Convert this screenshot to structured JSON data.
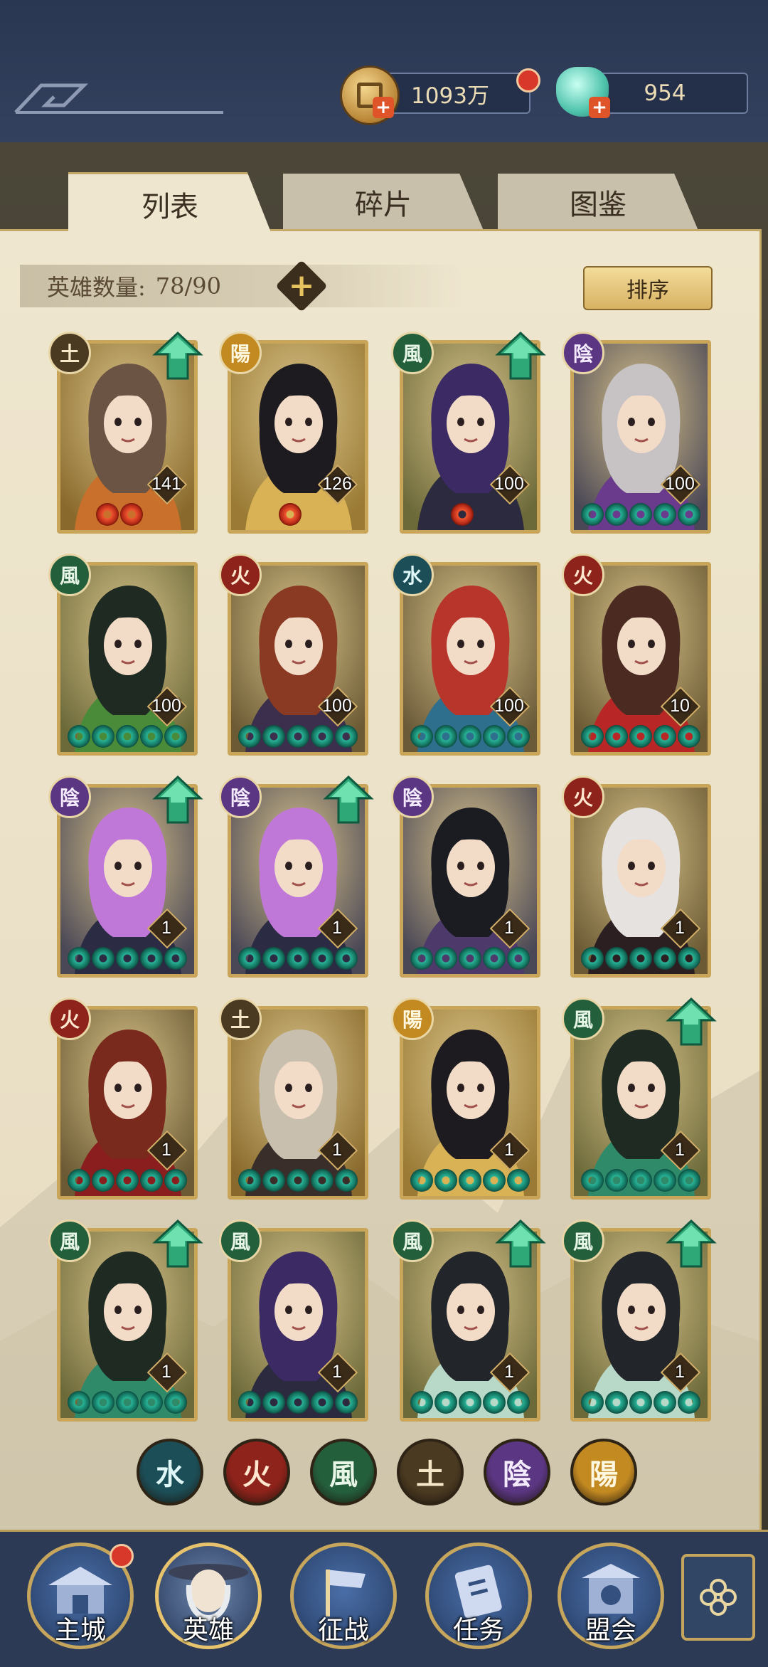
{
  "resources": {
    "gold_value": "1093万",
    "gem_value": "954",
    "gold_icon": "coin-icon",
    "gem_icon": "shell-gem-icon"
  },
  "tabs": [
    {
      "label": "列表",
      "active": true
    },
    {
      "label": "碎片",
      "active": false
    },
    {
      "label": "图鉴",
      "active": false
    }
  ],
  "hero_count": {
    "label": "英雄数量:",
    "value": "78/90"
  },
  "sort_button": {
    "label": "排序"
  },
  "element_glyphs": {
    "earth": "土",
    "yang": "陽",
    "wind": "風",
    "yin": "陰",
    "fire": "火",
    "water": "水"
  },
  "heroes": [
    {
      "element": "earth",
      "level": "141",
      "star_type": "red",
      "stars": 2,
      "upgrade": true,
      "hair": "#6b5444",
      "outfit": "#c9712c"
    },
    {
      "element": "yang",
      "level": "126",
      "star_type": "red",
      "stars": 1,
      "upgrade": false,
      "hair": "#1d1b1f",
      "outfit": "#d8b254"
    },
    {
      "element": "wind",
      "level": "100",
      "star_type": "red",
      "stars": 1,
      "upgrade": true,
      "hair": "#3b2a63",
      "outfit": "#2b2a3e"
    },
    {
      "element": "yin",
      "level": "100",
      "star_type": "jade",
      "stars": 5,
      "upgrade": false,
      "hair": "#c7c2c4",
      "outfit": "#6a3b8c"
    },
    {
      "element": "wind",
      "level": "100",
      "star_type": "jade",
      "stars": 5,
      "upgrade": false,
      "hair": "#1f2a22",
      "outfit": "#4a8b3a"
    },
    {
      "element": "fire",
      "level": "100",
      "star_type": "jade",
      "stars": 5,
      "upgrade": false,
      "hair": "#8a3a22",
      "outfit": "#3b2f4d"
    },
    {
      "element": "water",
      "level": "100",
      "star_type": "jade",
      "stars": 5,
      "upgrade": false,
      "hair": "#b8352b",
      "outfit": "#2f6f8e"
    },
    {
      "element": "fire",
      "level": "10",
      "star_type": "jade",
      "stars": 5,
      "upgrade": false,
      "hair": "#4b2a22",
      "outfit": "#b82626"
    },
    {
      "element": "yin",
      "level": "1",
      "star_type": "jade",
      "stars": 5,
      "upgrade": true,
      "hair": "#c078d8",
      "outfit": "#2b2b44"
    },
    {
      "element": "yin",
      "level": "1",
      "star_type": "jade",
      "stars": 5,
      "upgrade": true,
      "hair": "#c078d8",
      "outfit": "#2b2b44"
    },
    {
      "element": "yin",
      "level": "1",
      "star_type": "jade",
      "stars": 5,
      "upgrade": false,
      "hair": "#1b1b22",
      "outfit": "#4d3a6a"
    },
    {
      "element": "fire",
      "level": "1",
      "star_type": "jade",
      "stars": 5,
      "upgrade": false,
      "hair": "#e6e2e0",
      "outfit": "#2b1f22"
    },
    {
      "element": "fire",
      "level": "1",
      "star_type": "jade",
      "stars": 5,
      "upgrade": false,
      "hair": "#7a2a1c",
      "outfit": "#8a1e1e"
    },
    {
      "element": "earth",
      "level": "1",
      "star_type": "jade",
      "stars": 5,
      "upgrade": false,
      "hair": "#c8bfae",
      "outfit": "#3a2e2a"
    },
    {
      "element": "yang",
      "level": "1",
      "star_type": "jade",
      "stars": 5,
      "upgrade": false,
      "hair": "#1d1b1f",
      "outfit": "#d8b254"
    },
    {
      "element": "wind",
      "level": "1",
      "star_type": "jade",
      "stars": 5,
      "upgrade": true,
      "hair": "#1f2a22",
      "outfit": "#2f8a6a"
    },
    {
      "element": "wind",
      "level": "1",
      "star_type": "jade",
      "stars": 5,
      "upgrade": true,
      "hair": "#1f2a22",
      "outfit": "#2f8a6a"
    },
    {
      "element": "wind",
      "level": "1",
      "star_type": "jade",
      "stars": 5,
      "upgrade": false,
      "hair": "#3b2a63",
      "outfit": "#2b2a3e"
    },
    {
      "element": "wind",
      "level": "1",
      "star_type": "jade",
      "stars": 5,
      "upgrade": true,
      "hair": "#22262a",
      "outfit": "#b8d8c8"
    },
    {
      "element": "wind",
      "level": "1",
      "star_type": "jade",
      "stars": 5,
      "upgrade": true,
      "hair": "#22262a",
      "outfit": "#b8d8c8"
    }
  ],
  "filters": [
    "water",
    "fire",
    "wind",
    "earth",
    "yin",
    "yang"
  ],
  "nav": [
    {
      "label": "主城",
      "icon": "city-gate-icon",
      "active": false,
      "badge": true
    },
    {
      "label": "英雄",
      "icon": "hero-portrait-icon",
      "active": true,
      "badge": false
    },
    {
      "label": "征战",
      "icon": "battle-flag-icon",
      "active": false,
      "badge": false
    },
    {
      "label": "任务",
      "icon": "task-scroll-icon",
      "active": false,
      "badge": false
    },
    {
      "label": "盟会",
      "icon": "alliance-pavilion-icon",
      "active": false,
      "badge": false
    }
  ],
  "menu_icon": "flower-menu-icon"
}
